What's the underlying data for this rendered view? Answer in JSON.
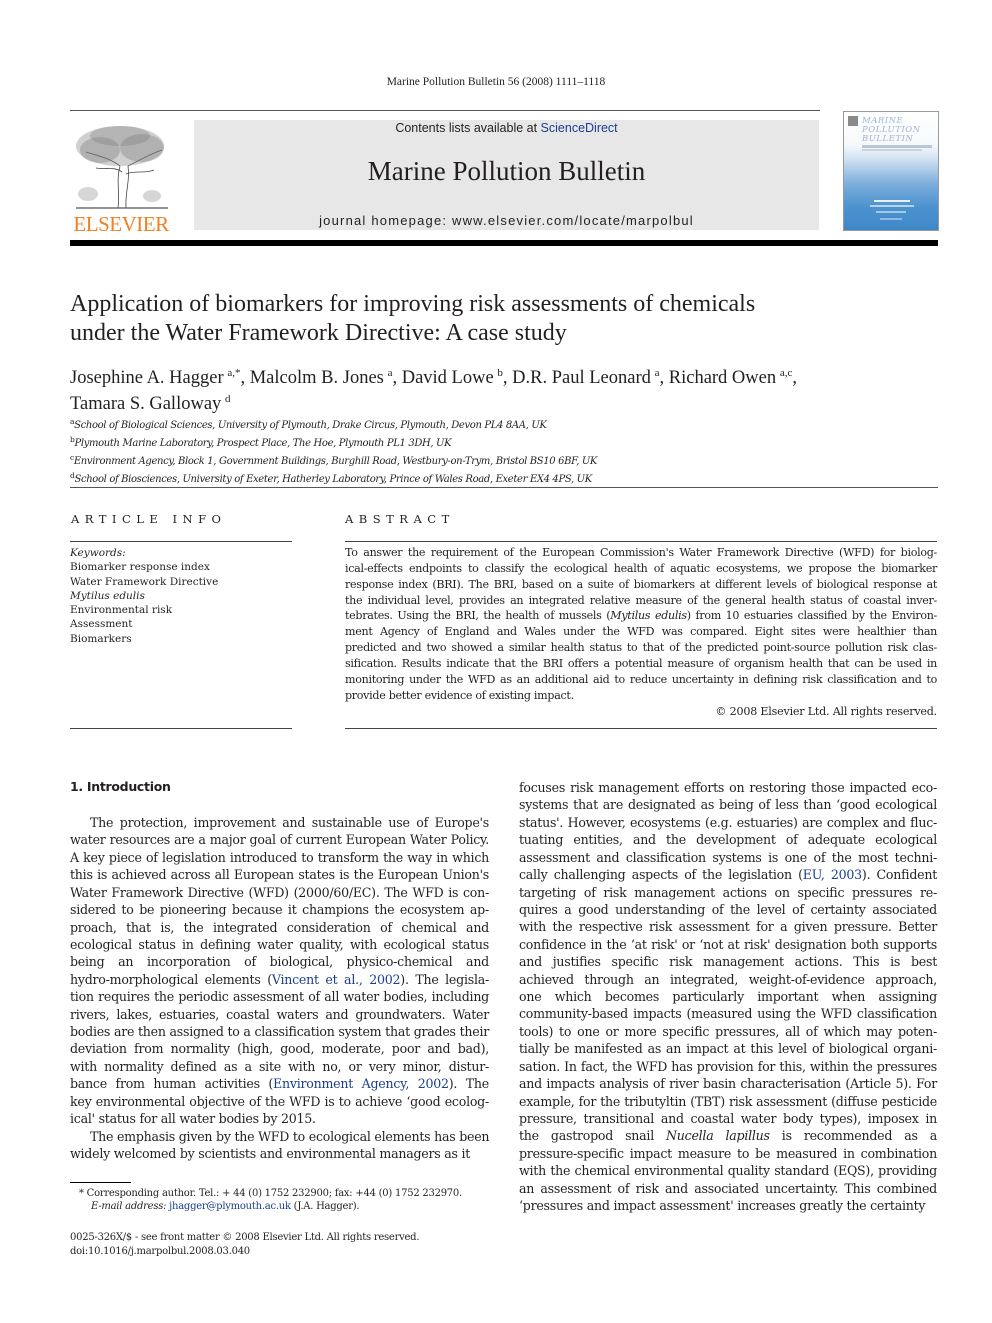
{
  "header": {
    "running_head": "Marine Pollution Bulletin 56 (2008) 1111–1118",
    "publisher_logo_text": "ELSEVIER",
    "contents_prefix": "Contents lists available at ",
    "contents_link": "ScienceDirect",
    "journal_title": "Marine Pollution Bulletin",
    "homepage": "journal homepage: www.elsevier.com/locate/marpolbul",
    "cover_title_lines": [
      "MARINE",
      "POLLUTION",
      "BULLETIN"
    ]
  },
  "article": {
    "title_lines": [
      "Application of biomarkers for improving risk assessments of chemicals",
      "under the Water Framework Directive: A case study"
    ],
    "authors": [
      {
        "name": "Josephine A. Hagger",
        "sup": "a,*"
      },
      {
        "name": "Malcolm B. Jones",
        "sup": "a"
      },
      {
        "name": "David Lowe",
        "sup": "b"
      },
      {
        "name": "D.R. Paul Leonard",
        "sup": "a"
      },
      {
        "name": "Richard Owen",
        "sup": "a,c"
      },
      {
        "name": "Tamara S. Galloway",
        "sup": "d"
      }
    ],
    "affiliations": [
      {
        "key": "a",
        "text": "School of Biological Sciences, University of Plymouth, Drake Circus, Plymouth, Devon PL4 8AA, UK"
      },
      {
        "key": "b",
        "text": "Plymouth Marine Laboratory, Prospect Place, The Hoe, Plymouth PL1 3DH, UK"
      },
      {
        "key": "c",
        "text": "Environment Agency, Block 1, Government Buildings, Burghill Road, Westbury-on-Trym, Bristol BS10 6BF, UK"
      },
      {
        "key": "d",
        "text": "School of Biosciences, University of Exeter, Hatherley Laboratory, Prince of Wales Road, Exeter EX4 4PS, UK"
      }
    ]
  },
  "article_info": {
    "heading": "ARTICLE INFO",
    "keywords_label": "Keywords:",
    "keywords": [
      "Biomarker response index",
      "Water Framework Directive",
      "Mytilus edulis",
      "Environmental risk",
      "Assessment",
      "Biomarkers"
    ]
  },
  "abstract": {
    "heading": "ABSTRACT",
    "lines": [
      "To answer the requirement of the European Commission's Water Framework Directive (WFD) for biolog-",
      "ical-effects endpoints to classify the ecological health of aquatic ecosystems, we propose the biomarker",
      "response index (BRI). The BRI, based on a suite of biomarkers at different levels of biological response at",
      "the individual level, provides an integrated relative measure of the general health status of coastal inver-",
      [
        "tebrates. Using the BRI, the health of mussels (",
        "Mytilus edulis",
        ") from 10 estuaries classified by the Environ-"
      ],
      "ment Agency of England and Wales under the WFD was compared. Eight sites were healthier than",
      "predicted and two showed a similar health status to that of the predicted point-source pollution risk clas-",
      "sification. Results indicate that the BRI offers a potential measure of organism health that can be used in",
      "monitoring under the WFD as an additional aid to reduce uncertainty in defining risk classification and to",
      "provide better evidence of existing impact."
    ],
    "copyright": "© 2008 Elsevier Ltd. All rights reserved."
  },
  "body": {
    "section_heading": "1. Introduction",
    "col1_lines": [
      "The protection, improvement and sustainable use of Europe's",
      "water resources are a major goal of current European Water Policy.",
      "A key piece of legislation introduced to transform the way in which",
      "this is achieved across all European states is the European Union's",
      "Water Framework Directive (WFD) (2000/60/EC). The WFD is con-",
      "sidered to be pioneering because it champions the ecosystem ap-",
      "proach, that is, the integrated consideration of chemical and",
      "ecological status in defining water quality, with ecological status",
      "being an incorporation of biological, physico-chemical and",
      [
        "hydro-morphological elements (",
        "Vincent et al., 2002",
        "). The legisla-"
      ],
      "tion requires the periodic assessment of all water bodies, including",
      "rivers, lakes, estuaries, coastal waters and groundwaters. Water",
      "bodies are then assigned to a classification system that grades their",
      "deviation from normality (high, good, moderate, poor and bad),",
      "with normality defined as a site with no, or very minor, distur-",
      [
        "bance from human activities (",
        "Environment Agency, 2002",
        "). The"
      ],
      "key environmental objective of the WFD is to achieve ‘good ecolog-",
      "ical' status for all water bodies by 2015.",
      "The emphasis given by the WFD to ecological elements has been",
      "widely welcomed by scientists and environmental managers as it"
    ],
    "col2_lines": [
      "focuses risk management efforts on restoring those impacted eco-",
      "systems that are designated as being of less than ‘good ecological",
      "status'. However, ecosystems (e.g. estuaries) are complex and fluc-",
      "tuating entities, and the development of adequate ecological",
      "assessment and classification systems is one of the most techni-",
      [
        "cally challenging aspects of the legislation (",
        "EU, 2003",
        "). Confident"
      ],
      "targeting of risk management actions on specific pressures re-",
      "quires a good understanding of the level of certainty associated",
      "with the respective risk assessment for a given pressure. Better",
      "confidence in the ‘at risk' or ‘not at risk' designation both supports",
      "and justifies specific risk management actions. This is best",
      "achieved through an integrated, weight-of-evidence approach,",
      "one which becomes particularly important when assigning",
      "community-based impacts (measured using the WFD classification",
      "tools) to one or more specific pressures, all of which may poten-",
      "tially be manifested as an impact at this level of biological organi-",
      "sation. In fact, the WFD has provision for this, within the pressures",
      "and impacts analysis of river basin characterisation (Article 5). For",
      "example, for the tributyltin (TBT) risk assessment (diffuse pesticide",
      "pressure, transitional and coastal water body types), imposex in",
      [
        "the gastropod snail ",
        "Nucella lapillus",
        " is recommended as a"
      ],
      "pressure-specific impact measure to be measured in combination",
      "with the chemical environmental quality standard (EQS), providing",
      "an assessment of risk and associated uncertainty. This combined",
      "‘pressures and impact assessment' increases greatly the certainty"
    ]
  },
  "footnotes": {
    "corresponding": "*  Corresponding author. Tel.: + 44 (0) 1752 232900; fax: +44 (0) 1752 232970.",
    "email_label": "E-mail address: ",
    "email": "jhagger@plymouth.ac.uk",
    "email_suffix": " (J.A. Hagger).",
    "issn": "0025-326X/$ - see front matter © 2008 Elsevier Ltd. All rights reserved.",
    "doi": "doi:10.1016/j.marpolbul.2008.03.040"
  },
  "colors": {
    "elsevier_orange": "#f07f22",
    "link_blue": "#1a3d8f",
    "banner_gray": "#e7e7e7"
  }
}
